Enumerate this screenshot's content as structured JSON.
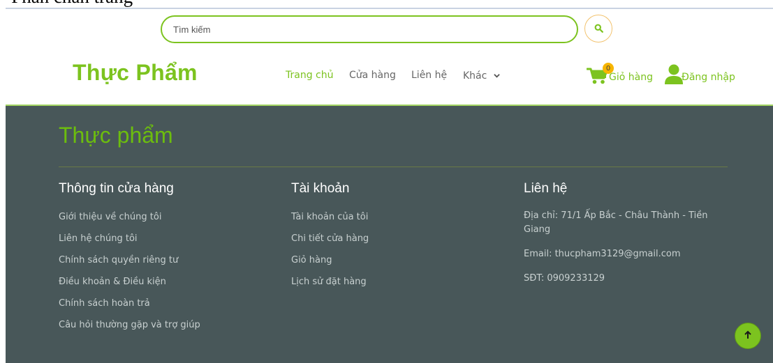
{
  "doc": {
    "heading": "• Phần chân trang"
  },
  "search": {
    "placeholder": "Tìm kiếm"
  },
  "header": {
    "logo": "Thực Phẩm",
    "nav": [
      {
        "label": "Trang chủ",
        "active": true
      },
      {
        "label": "Cửa hàng"
      },
      {
        "label": "Liên hệ"
      },
      {
        "label": "Khác"
      }
    ],
    "cart": {
      "label": "Giỏ hàng",
      "count": "0"
    },
    "login": {
      "label": "Đăng nhập"
    }
  },
  "footer": {
    "brand": "Thực phẩm",
    "columns": [
      {
        "title": "Thông tin cửa hàng",
        "links": [
          "Giới thiệu về chúng tôi",
          "Liên hệ chúng tôi",
          "Chính sách quyền riêng tư",
          "Điều khoản & Điều kiện",
          "Chính sách hoàn trả",
          "Câu hỏi thường gặp và trợ giúp"
        ]
      },
      {
        "title": "Tài khoản",
        "links": [
          "Tài khoản của tôi",
          "Chi tiết cửa hàng",
          "Giỏ hàng",
          "Lịch sử đặt hàng"
        ]
      }
    ],
    "contact": {
      "title": "Liên hệ",
      "address": "Địa chỉ: 71/1 Ấp Bắc - Châu Thành - Tiền Giang",
      "email": "Email: thucpham3129@gmail.com",
      "phone": "SĐT: 0909233129"
    }
  },
  "icons": {
    "search": "search-icon",
    "chevron": "chevron-down-icon",
    "cart": "cart-icon",
    "user": "user-icon",
    "arrow_up": "arrow-up-icon"
  },
  "colors": {
    "accent": "#7cc31f",
    "footer_bg": "#485759",
    "badge": "#f7b500"
  }
}
